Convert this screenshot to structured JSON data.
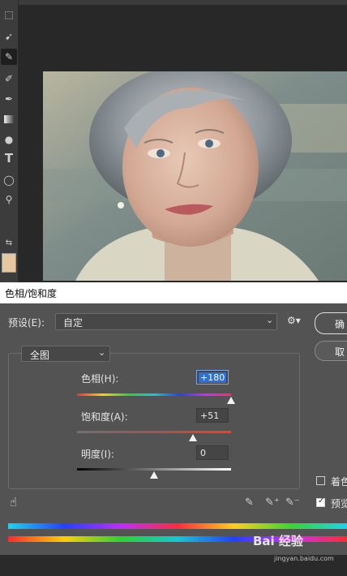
{
  "dialog": {
    "title": "色相/饱和度",
    "preset_label": "预设(E):",
    "preset_value": "自定",
    "channel_value": "全图",
    "hue": {
      "label": "色相(H):",
      "value": "+180",
      "level": 1.0
    },
    "saturation": {
      "label": "饱和度(A):",
      "value": "+51",
      "level": 0.755
    },
    "lightness": {
      "label": "明度(I):",
      "value": "0",
      "level": 0.5
    },
    "ok_label": "确",
    "cancel_label": "取",
    "colorize_label": "着色",
    "preview_label": "预览",
    "colorize_checked": false,
    "preview_checked": true
  },
  "watermark": {
    "text": "Bai 经验",
    "url": "jingyan.baidu.com"
  },
  "icons": {
    "toolbar": [
      "marquee-icon",
      "lasso-icon",
      "eyedropper-icon",
      "brush-icon",
      "clone-stamp-icon",
      "eraser-icon",
      "gradient-icon",
      "blur-icon",
      "pen-icon",
      "type-icon",
      "ellipse-icon",
      "zoom-icon",
      "swap-colors-icon",
      "foreground-color-swatch"
    ],
    "dialog": [
      "preset-settings-icon",
      "target-adjust-icon",
      "eyedropper-icon",
      "add-eyedropper-icon",
      "subtract-eyedropper-icon"
    ]
  }
}
